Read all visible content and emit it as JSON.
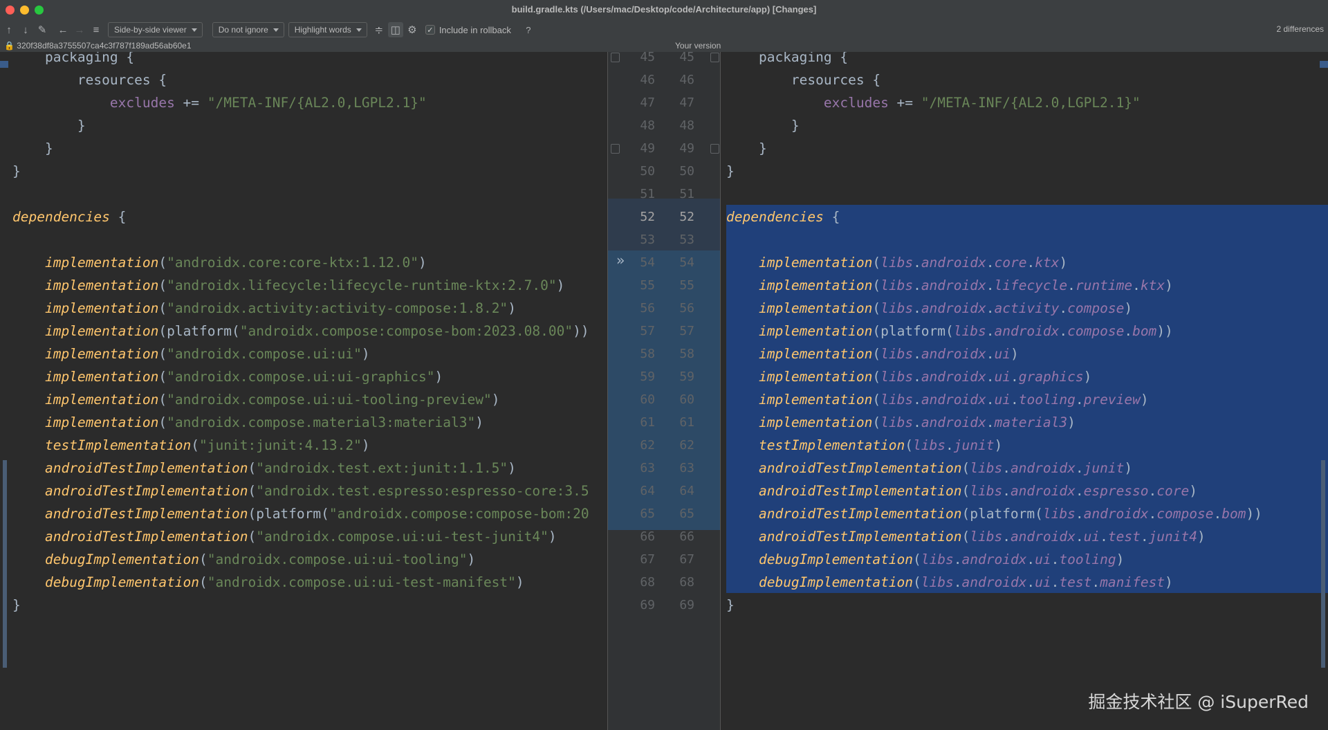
{
  "window": {
    "title": "build.gradle.kts (/Users/mac/Desktop/code/Architecture/app) [Changes]"
  },
  "toolbar": {
    "viewer_mode": "Side-by-side viewer",
    "whitespace_mode": "Do not ignore",
    "highlight_mode": "Highlight words",
    "include_in_rollback_label": "Include in rollback",
    "include_in_rollback_checked": true,
    "help_label": "?",
    "differences_count": "2 differences",
    "icons": [
      "arrow-up-icon",
      "arrow-down-icon",
      "edit-icon",
      "arrow-left-icon",
      "arrow-right-icon",
      "list-icon",
      "collapse-unchanged-icon",
      "sync-scroll-icon",
      "settings-icon"
    ]
  },
  "info": {
    "revision_hash": "320f38df8a3755507ca4c3f787f189ad56ab60e1",
    "right_header": "Your version"
  },
  "gutter": {
    "line_numbers": [
      "45",
      "46",
      "47",
      "48",
      "49",
      "50",
      "51",
      "52",
      "53",
      "54",
      "55",
      "56",
      "57",
      "58",
      "59",
      "60",
      "61",
      "62",
      "63",
      "64",
      "65",
      "66",
      "67",
      "68",
      "69"
    ]
  },
  "left_lines": [
    "    packaging {",
    "        resources {",
    "            excludes += \"/META-INF/{AL2.0,LGPL2.1}\"",
    "        }",
    "    }",
    "}",
    "",
    "dependencies {",
    "",
    "    implementation(\"androidx.core:core-ktx:1.12.0\")",
    "    implementation(\"androidx.lifecycle:lifecycle-runtime-ktx:2.7.0\")",
    "    implementation(\"androidx.activity:activity-compose:1.8.2\")",
    "    implementation(platform(\"androidx.compose:compose-bom:2023.08.00\"))",
    "    implementation(\"androidx.compose.ui:ui\")",
    "    implementation(\"androidx.compose.ui:ui-graphics\")",
    "    implementation(\"androidx.compose.ui:ui-tooling-preview\")",
    "    implementation(\"androidx.compose.material3:material3\")",
    "    testImplementation(\"junit:junit:4.13.2\")",
    "    androidTestImplementation(\"androidx.test.ext:junit:1.1.5\")",
    "    androidTestImplementation(\"androidx.test.espresso:espresso-core:3.5",
    "    androidTestImplementation(platform(\"androidx.compose:compose-bom:20",
    "    androidTestImplementation(\"androidx.compose.ui:ui-test-junit4\")",
    "    debugImplementation(\"androidx.compose.ui:ui-tooling\")",
    "    debugImplementation(\"androidx.compose.ui:ui-test-manifest\")",
    "}"
  ],
  "right_lines": [
    "    packaging {",
    "        resources {",
    "            excludes += \"/META-INF/{AL2.0,LGPL2.1}\"",
    "        }",
    "    }",
    "}",
    "",
    "dependencies {",
    "",
    "    implementation(libs.androidx.core.ktx)",
    "    implementation(libs.androidx.lifecycle.runtime.ktx)",
    "    implementation(libs.androidx.activity.compose)",
    "    implementation(platform(libs.androidx.compose.bom))",
    "    implementation(libs.androidx.ui)",
    "    implementation(libs.androidx.ui.graphics)",
    "    implementation(libs.androidx.ui.tooling.preview)",
    "    implementation(libs.androidx.material3)",
    "    testImplementation(libs.junit)",
    "    androidTestImplementation(libs.androidx.junit)",
    "    androidTestImplementation(libs.androidx.espresso.core)",
    "    androidTestImplementation(platform(libs.androidx.compose.bom))",
    "    androidTestImplementation(libs.androidx.ui.test.junit4)",
    "    debugImplementation(libs.androidx.ui.tooling)",
    "    debugImplementation(libs.androidx.ui.test.manifest)",
    "}"
  ],
  "watermark": "掘金技术社区 @ iSuperRed",
  "colors": {
    "editor_bg": "#2b2b2b",
    "changed_bg": "#20407a",
    "function_call": "#ffc66d",
    "string": "#6a8759",
    "property": "#9876aa",
    "default_text": "#a9b7c6"
  }
}
